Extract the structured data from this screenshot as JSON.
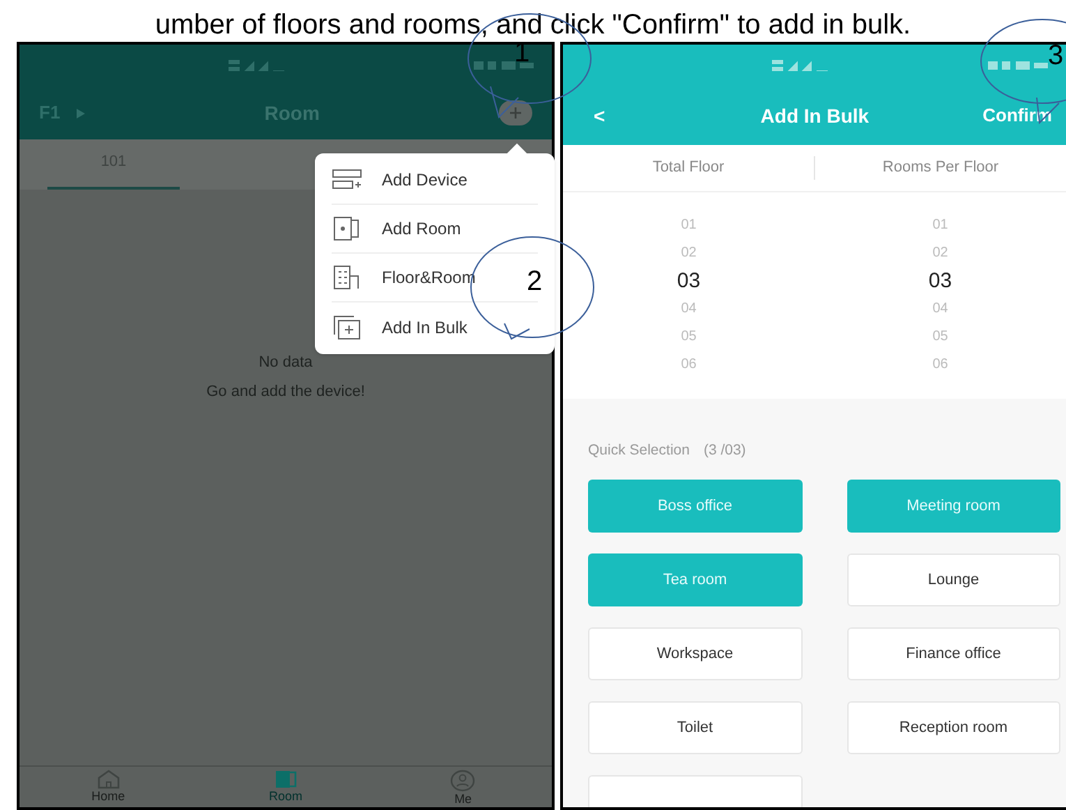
{
  "caption": "umber of floors and rooms, and click \"Confirm\" to add in bulk.",
  "room_screen": {
    "floor": "F1",
    "title": "Room",
    "tabs": [
      {
        "label": "101",
        "selected": true
      }
    ],
    "menu": [
      {
        "label": "Add Device",
        "kind": "device"
      },
      {
        "label": "Add Room",
        "kind": "room"
      },
      {
        "label": "Floor&Room",
        "kind": "floor"
      },
      {
        "label": "Add In Bulk",
        "kind": "bulk"
      }
    ],
    "empty_title": "No data",
    "empty_hint": "Go and add the device!",
    "nav": [
      {
        "label": "Home",
        "kind": "home",
        "selected": false
      },
      {
        "label": "Room",
        "kind": "room",
        "selected": true
      },
      {
        "label": "Me",
        "kind": "me",
        "selected": false
      }
    ]
  },
  "bulk_screen": {
    "back": "<",
    "title": "Add In Bulk",
    "confirm": "Confirm",
    "columns": [
      {
        "label": "Total Floor",
        "options": [
          {
            "label": "01",
            "selected": false
          },
          {
            "label": "02",
            "selected": false
          },
          {
            "label": "03",
            "selected": true
          },
          {
            "label": "04",
            "selected": false
          },
          {
            "label": "05",
            "selected": false
          },
          {
            "label": "06",
            "selected": false
          }
        ]
      },
      {
        "label": "Rooms Per Floor",
        "options": [
          {
            "label": "01",
            "selected": false
          },
          {
            "label": "02",
            "selected": false
          },
          {
            "label": "03",
            "selected": true
          },
          {
            "label": "04",
            "selected": false
          },
          {
            "label": "05",
            "selected": false
          },
          {
            "label": "06",
            "selected": false
          }
        ]
      }
    ],
    "quick_selection": {
      "label": "Quick Selection",
      "count": "(3 /03)"
    },
    "rooms": [
      {
        "label": "Boss office",
        "selected": true
      },
      {
        "label": "Meeting room",
        "selected": true
      },
      {
        "label": "Tea room",
        "selected": true
      },
      {
        "label": "Lounge",
        "selected": false
      },
      {
        "label": "Workspace",
        "selected": false
      },
      {
        "label": "Finance office",
        "selected": false
      },
      {
        "label": "Toilet",
        "selected": false
      },
      {
        "label": "Reception room",
        "selected": false
      }
    ],
    "more_below": true
  },
  "callouts": [
    {
      "label": "1"
    },
    {
      "label": "2"
    },
    {
      "label": "3"
    }
  ]
}
